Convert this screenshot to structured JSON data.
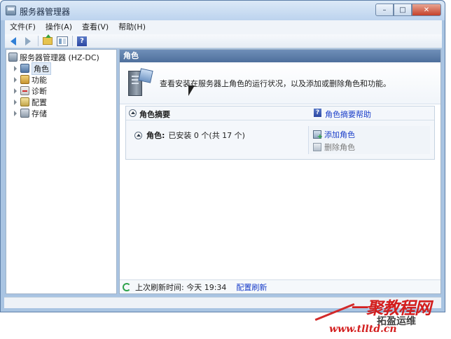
{
  "window": {
    "title": "服务器管理器"
  },
  "window_buttons": {
    "minimize": "–",
    "maximize": "□",
    "close": "✕"
  },
  "menu": [
    "文件(F)",
    "操作(A)",
    "查看(V)",
    "帮助(H)"
  ],
  "toolbar": {
    "icons": [
      "back-arrow-icon",
      "forward-arrow-icon",
      "up-folder-icon",
      "show-tree-icon",
      "help-icon"
    ],
    "help_glyph": "?"
  },
  "tree": {
    "root": "服务器管理器 (HZ-DC)",
    "items": [
      {
        "label": "角色",
        "icon": "roles-icon",
        "selected": true
      },
      {
        "label": "功能",
        "icon": "features-icon"
      },
      {
        "label": "诊断",
        "icon": "diagnostics-icon"
      },
      {
        "label": "配置",
        "icon": "configuration-icon"
      },
      {
        "label": "存储",
        "icon": "storage-icon"
      }
    ]
  },
  "main": {
    "header": "角色",
    "intro": "查看安装在服务器上角色的运行状况，以及添加或删除角色和功能。",
    "summary": {
      "title": "角色摘要",
      "help_link": "角色摘要帮助",
      "roles_label": "角色:",
      "roles_status": "已安装 0 个(共 17 个)",
      "actions": {
        "add": "添加角色",
        "remove": "删除角色"
      }
    },
    "footer": {
      "last_refresh": "上次刷新时间: 今天 19:34",
      "configure_refresh": "配置刷新"
    }
  },
  "watermark": {
    "brand": "一聚教程网",
    "sub": "拓盈运维",
    "url": "www.tlltd.cn"
  },
  "colors": {
    "accent": "#1a3ec9",
    "header": "#5a7aa8",
    "watermark": "#d31e1e"
  }
}
